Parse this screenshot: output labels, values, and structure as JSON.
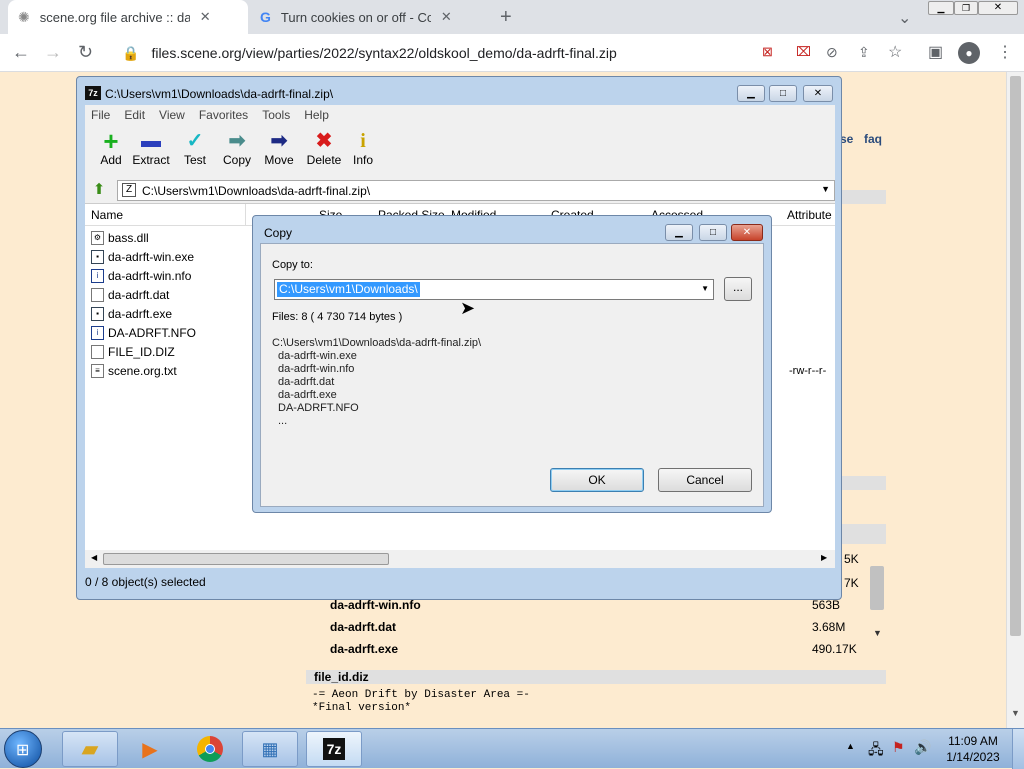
{
  "browser": {
    "tabs": [
      {
        "title": "scene.org file archive :: da-adrft-f",
        "close": "✕"
      },
      {
        "title": "Turn cookies on or off - Compute",
        "close": "✕"
      }
    ],
    "new_tab": "+",
    "url": "files.scene.org/view/parties/2022/syntax22/oldskool_demo/da-adrft-final.zip"
  },
  "webpage": {
    "nav_fragment": "se",
    "nav_faq": "faq",
    "files": [
      {
        "name": "da-adrft-win.nfo",
        "size": "563B"
      },
      {
        "name": "da-adrft.dat",
        "size": "3.68M"
      },
      {
        "name": "da-adrft.exe",
        "size": "490.17K"
      }
    ],
    "partial_sizes": [
      "5K",
      "7K"
    ],
    "section_title": "file_id.diz",
    "diz_lines": [
      "-= Aeon Drift by Disaster Area =-",
      "*Final version*"
    ]
  },
  "sevenzip": {
    "title": "C:\\Users\\vm1\\Downloads\\da-adrft-final.zip\\",
    "logo": "7z",
    "menu": [
      "File",
      "Edit",
      "View",
      "Favorites",
      "Tools",
      "Help"
    ],
    "tools": [
      {
        "label": "Add",
        "icon": "+",
        "color": "#19b01f"
      },
      {
        "label": "Extract",
        "icon": "▬",
        "color": "#2b3fbd"
      },
      {
        "label": "Test",
        "icon": "✓",
        "color": "#17b7c4"
      },
      {
        "label": "Copy",
        "icon": "➡",
        "color": "#4a8c8c"
      },
      {
        "label": "Move",
        "icon": "➡",
        "color": "#1d2a84"
      },
      {
        "label": "Delete",
        "icon": "✖",
        "color": "#d81b1b"
      },
      {
        "label": "Info",
        "icon": "i",
        "color": "#c9a300"
      }
    ],
    "address": "C:\\Users\\vm1\\Downloads\\da-adrft-final.zip\\",
    "columns": [
      "Name",
      "Size",
      "Packed Size",
      "Modified",
      "Created",
      "Accessed",
      "Attribute"
    ],
    "files": [
      "bass.dll",
      "da-adrft-win.exe",
      "da-adrft-win.nfo",
      "da-adrft.dat",
      "da-adrft.exe",
      "DA-ADRFT.NFO",
      "FILE_ID.DIZ",
      "scene.org.txt"
    ],
    "attr_last": "-rw-r--r-",
    "status": "0 / 8 object(s) selected"
  },
  "copy_dialog": {
    "title": "Copy",
    "copy_to_label": "Copy to:",
    "path": "C:\\Users\\vm1\\Downloads\\",
    "browse": "...",
    "files_info": "Files: 8    ( 4 730 714 bytes )",
    "list": [
      "C:\\Users\\vm1\\Downloads\\da-adrft-final.zip\\",
      "  da-adrft-win.exe",
      "  da-adrft-win.nfo",
      "  da-adrft.dat",
      "  da-adrft.exe",
      "  DA-ADRFT.NFO",
      "  ..."
    ],
    "ok": "OK",
    "cancel": "Cancel"
  },
  "taskbar": {
    "time": "11:09 AM",
    "date": "1/14/2023",
    "pinned_logo": "7z"
  }
}
